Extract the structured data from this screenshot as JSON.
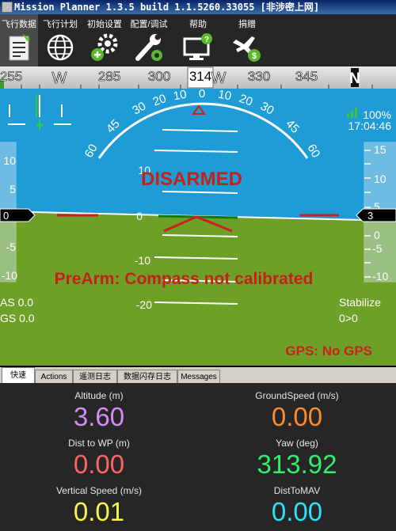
{
  "window": {
    "title": "Mission Planner 1.3.5 build 1.1.5260.33055 [非涉密上网]"
  },
  "menu": [
    {
      "label": "飞行数据",
      "icon": "flight-data-icon",
      "active": true
    },
    {
      "label": "飞行计划",
      "icon": "globe-icon",
      "active": false
    },
    {
      "label": "初始设置",
      "icon": "gears-icon",
      "active": false
    },
    {
      "label": "配置/调试",
      "icon": "wrench-icon",
      "active": false
    },
    {
      "label": "帮助",
      "icon": "monitor-help-icon",
      "active": false
    },
    {
      "label": "捐赠",
      "icon": "plane-donate-icon",
      "active": false
    }
  ],
  "compass": {
    "labels": [
      "255",
      "W",
      "285",
      "300",
      "314",
      "W",
      "330",
      "345",
      "N"
    ],
    "current": "314"
  },
  "hud": {
    "status": "DISARMED",
    "prearm_message": "PreArm: Compass not calibrated",
    "gps_status": "GPS: No GPS",
    "battery_percent": "100%",
    "clock": "17:04:46",
    "airspeed": "AS 0.0",
    "groundspeed": "GS 0.0",
    "mode": "Stabilize",
    "wp": "0>0",
    "speed_box": "0",
    "alt_box": "3",
    "roll_scale": [
      "60",
      "45",
      "30",
      "20",
      "10",
      "0",
      "10",
      "20",
      "30",
      "45",
      "60"
    ],
    "pitch_labels": [
      "10",
      "0",
      "-10",
      "-20"
    ],
    "speed_tape": [
      "10",
      "5",
      "0",
      "-5",
      "-10"
    ],
    "alt_tape": [
      "15",
      "10",
      "5",
      "0",
      "-5",
      "-10"
    ],
    "colors": {
      "sky": "#1f9bd6",
      "ground": "#6ea028",
      "warn": "#c0221b",
      "gps": "#cc1f1f"
    }
  },
  "tabs": [
    {
      "label": "快速",
      "active": true
    },
    {
      "label": "Actions",
      "active": false
    },
    {
      "label": "遥测日志",
      "active": false
    },
    {
      "label": "数据闪存日志",
      "active": false
    },
    {
      "label": "Messages",
      "active": false
    }
  ],
  "quick": [
    {
      "label": "Altitude (m)",
      "value": "3.60",
      "color": "#d58cf5"
    },
    {
      "label": "GroundSpeed (m/s)",
      "value": "0.00",
      "color": "#fb8b2c"
    },
    {
      "label": "Dist to WP (m)",
      "value": "0.00",
      "color": "#fb6566"
    },
    {
      "label": "Yaw (deg)",
      "value": "313.92",
      "color": "#34ed6a"
    },
    {
      "label": "Vertical Speed (m/s)",
      "value": "0.01",
      "color": "#f9f54b"
    },
    {
      "label": "DistToMAV",
      "value": "0.00",
      "color": "#2fe0f8"
    }
  ]
}
